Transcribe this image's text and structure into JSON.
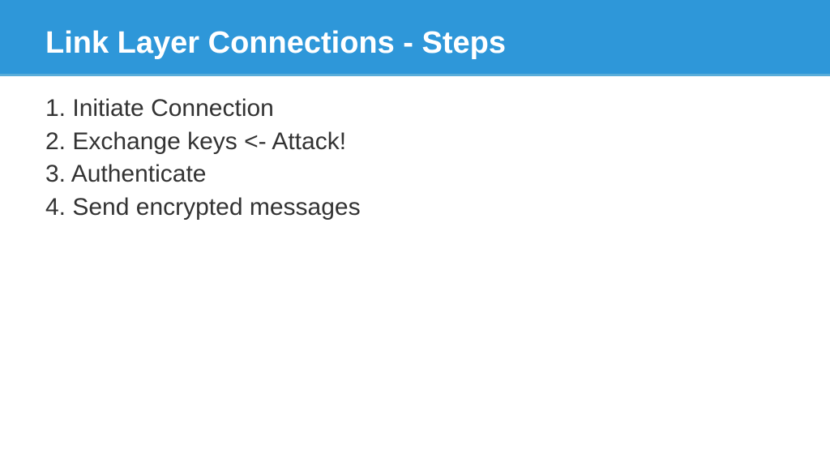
{
  "header": {
    "title": "Link Layer Connections - Steps"
  },
  "steps": [
    "1. Initiate Connection",
    "2. Exchange keys <- Attack!",
    "3. Authenticate",
    "4. Send encrypted messages"
  ]
}
